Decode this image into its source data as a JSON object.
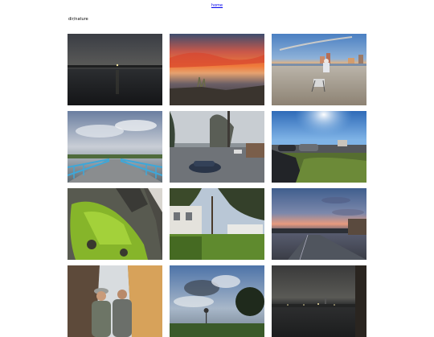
{
  "nav": {
    "home_label": "home"
  },
  "breadcrumb": {
    "path": "dir/nature"
  },
  "photos": [
    {
      "name": "photo-bay-dusk"
    },
    {
      "name": "photo-sunset-shore"
    },
    {
      "name": "photo-beach-city"
    },
    {
      "name": "photo-bridge-clouds"
    },
    {
      "name": "photo-parking-street"
    },
    {
      "name": "photo-sunny-parking"
    },
    {
      "name": "photo-mossy-rocks"
    },
    {
      "name": "photo-house-yard"
    },
    {
      "name": "photo-twilight-street"
    },
    {
      "name": "photo-waterfall-friends"
    },
    {
      "name": "photo-cloudy-park"
    },
    {
      "name": "photo-night-harbor"
    }
  ]
}
